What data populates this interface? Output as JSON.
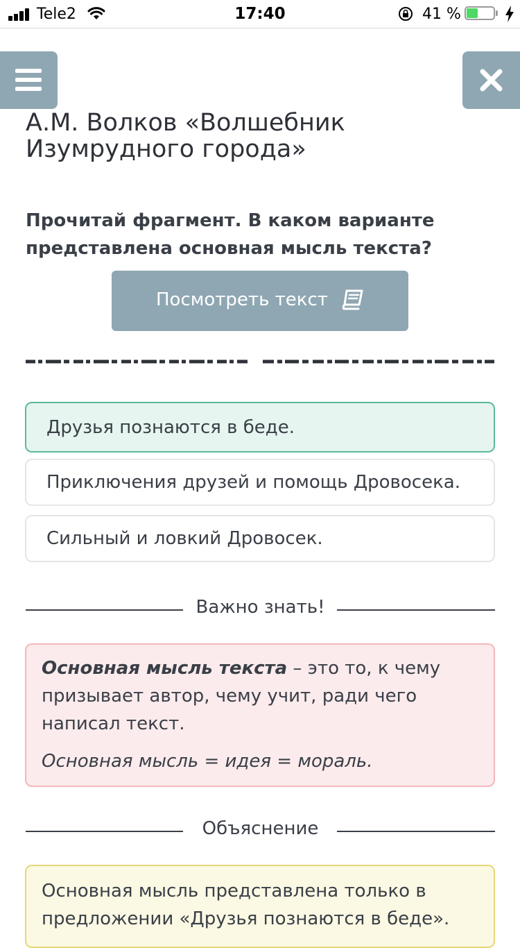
{
  "status_bar": {
    "carrier": "Tele2",
    "time": "17:40",
    "battery_percent": "41 %",
    "battery_level": 0.41
  },
  "nav": {
    "menu_icon": "hamburger-icon",
    "close_icon": "close-icon"
  },
  "title": "А.М. Волков «Волшебник Изумрудного города»",
  "question": "Прочитай фрагмент. В каком варианте представлена основная мысль текста?",
  "view_text_button": {
    "label": "Посмотреть текст",
    "icon": "book-icon"
  },
  "options": [
    {
      "text": "Друзья познаются в беде.",
      "selected": true
    },
    {
      "text": "Приключения друзей и помощь Дровосека.",
      "selected": false
    },
    {
      "text": "Сильный и ловкий Дровосек.",
      "selected": false
    }
  ],
  "important_section": {
    "heading": "Важно знать!",
    "term": "Основная мысль текста",
    "definition": " – это то, к чему призывает автор, чему учит, ради чего написал текст.",
    "formula": "Основная мысль = идея = мораль."
  },
  "explanation_section": {
    "heading": "Объяснение",
    "text": "Основная мысль представлена только в предложении «Друзья познаются в беде»."
  },
  "colors": {
    "accent_gray_blue": "#8fa7b3",
    "selected_bg": "#e6f5ef",
    "selected_border": "#5ab99a",
    "info_bg": "#fbebec",
    "info_border": "#f3b8bc",
    "explain_bg": "#fbf8e3",
    "explain_border": "#e4d776",
    "battery_green": "#4cd964"
  }
}
